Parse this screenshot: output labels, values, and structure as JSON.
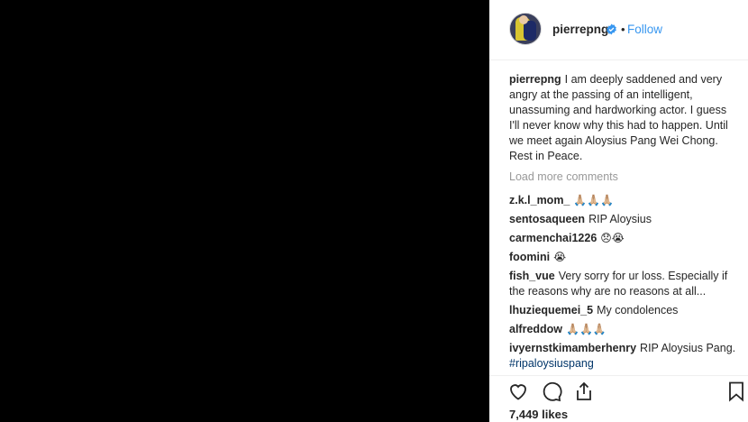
{
  "post": {
    "username": "pierrepng",
    "follow_label": "Follow",
    "separator": "•",
    "caption_user": "pierrepng",
    "caption_text": "I am deeply saddened and very angry at the passing of an intelligent, unassuming and hardworking actor. I guess I'll never know why this had to happen. Until we meet again Aloysius Pang Wei Chong. Rest in Peace.",
    "load_more_label": "Load more comments",
    "likes": "7,449 likes"
  },
  "comments": [
    {
      "user": "z.k.l_mom_",
      "text": "🙏🏼🙏🏼🙏🏼"
    },
    {
      "user": "sentosaqueen",
      "text": "RIP Aloysius"
    },
    {
      "user": "carmenchai1226",
      "text": "😞😭"
    },
    {
      "user": "foomini",
      "text": "😭"
    },
    {
      "user": "fish_vue",
      "text": "Very sorry for ur loss. Especially if the reasons why are no reasons at all..."
    },
    {
      "user": "lhuziequemei_5",
      "text": "My condolences"
    },
    {
      "user": "alfreddow",
      "text": "🙏🏼🙏🏼🙏🏼"
    },
    {
      "user": "ivyernstkimamberhenry",
      "text": "RIP Aloysius Pang.",
      "hashtag": "#ripaloysiuspang"
    }
  ],
  "icons": {
    "verified": "verified-badge-icon",
    "like": "heart-icon",
    "comment": "comment-bubble-icon",
    "share": "share-icon",
    "save": "bookmark-icon"
  },
  "colors": {
    "link": "#3897f0",
    "hashtag": "#003569",
    "muted": "#999999",
    "media_background": "#000000"
  }
}
